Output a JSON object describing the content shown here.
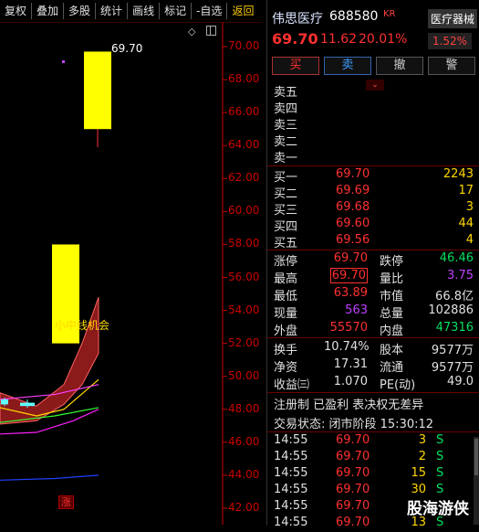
{
  "toolbar": {
    "items": [
      "复权",
      "叠加",
      "多股",
      "统计",
      "画线",
      "标记",
      "-自选",
      "返回"
    ]
  },
  "chart_data": {
    "type": "candlestick",
    "y_ticks": [
      "70.00",
      "68.00",
      "66.00",
      "64.00",
      "62.00",
      "60.00",
      "58.00",
      "56.00",
      "54.00",
      "52.00",
      "50.00",
      "48.00",
      "46.00",
      "44.00",
      "42.00"
    ],
    "ylim": [
      41.0,
      71.5
    ],
    "candles": [
      {
        "open": 48.3,
        "close": 48.6,
        "high": 48.7,
        "low": 48.2,
        "color": "cyan"
      },
      {
        "open": 48.2,
        "close": 48.4,
        "high": 48.6,
        "low": 48.1,
        "color": "cyan"
      },
      {
        "open": 58.0,
        "close": 52.0,
        "high": 58.0,
        "low": 52.0,
        "color": "yellow"
      },
      {
        "open": 65.0,
        "close": 69.7,
        "high": 69.7,
        "low": 63.9,
        "color": "yellow"
      }
    ],
    "high_label": "69.70",
    "annotation": "小中线机会",
    "badge": "涨",
    "colors": {
      "up_candle": "#ffff00",
      "band_fill": "#8b1a1a",
      "axis": "#cc0000"
    }
  },
  "stock": {
    "name": "伟思医疗",
    "code": "688580",
    "tag": "KR",
    "price": "69.70",
    "change": "11.62",
    "change_pct": "20.01%",
    "sector": "医疗器械",
    "sector_pct": "1.52%"
  },
  "buttons": {
    "buy": "买",
    "sell": "卖",
    "cancel": "撤",
    "alert": "警"
  },
  "sell_levels": [
    "卖五",
    "卖四",
    "卖三",
    "卖二",
    "卖一"
  ],
  "buy_levels": [
    {
      "label": "买一",
      "price": "69.70",
      "vol": "2243"
    },
    {
      "label": "买二",
      "price": "69.69",
      "vol": "17"
    },
    {
      "label": "买三",
      "price": "69.68",
      "vol": "3"
    },
    {
      "label": "买四",
      "price": "69.60",
      "vol": "44"
    },
    {
      "label": "买五",
      "price": "69.56",
      "vol": "4"
    }
  ],
  "quote": [
    {
      "k1": "涨停",
      "v1": "69.70",
      "c1": "red",
      "k2": "跌停",
      "v2": "46.46",
      "c2": "green"
    },
    {
      "k1": "最高",
      "v1": "69.70",
      "c1": "red boxed",
      "k2": "量比",
      "v2": "3.75",
      "c2": "purple"
    },
    {
      "k1": "最低",
      "v1": "63.89",
      "c1": "red",
      "k2": "市值",
      "v2": "66.8亿",
      "c2": "white"
    },
    {
      "k1": "现量",
      "v1": "563",
      "c1": "purple",
      "k2": "总量",
      "v2": "102886",
      "c2": "white"
    },
    {
      "k1": "外盘",
      "v1": "55570",
      "c1": "red",
      "k2": "内盘",
      "v2": "47316",
      "c2": "green"
    }
  ],
  "quote2": [
    {
      "k1": "换手",
      "v1": "10.74%",
      "c1": "white",
      "k2": "股本",
      "v2": "9577万",
      "c2": "white"
    },
    {
      "k1": "净资",
      "v1": "17.31",
      "c1": "white",
      "k2": "流通",
      "v2": "9577万",
      "c2": "white"
    },
    {
      "k1": "收益㈢",
      "v1": "1.070",
      "c1": "white",
      "k2": "PE(动)",
      "v2": "49.0",
      "c2": "white"
    }
  ],
  "flags": "注册制 已盈利 表决权无差异",
  "status": "交易状态: 闭市阶段 15:30:12",
  "ticks": [
    {
      "t": "14:55",
      "p": "69.70",
      "v": "3",
      "s": "S"
    },
    {
      "t": "14:55",
      "p": "69.70",
      "v": "2",
      "s": "S"
    },
    {
      "t": "14:55",
      "p": "69.70",
      "v": "15",
      "s": "S"
    },
    {
      "t": "14:55",
      "p": "69.70",
      "v": "30",
      "s": "S"
    },
    {
      "t": "14:55",
      "p": "69.70",
      "v": "",
      "s": ""
    },
    {
      "t": "14:55",
      "p": "69.70",
      "v": "13",
      "s": "S"
    }
  ],
  "watermark": "股海游侠"
}
